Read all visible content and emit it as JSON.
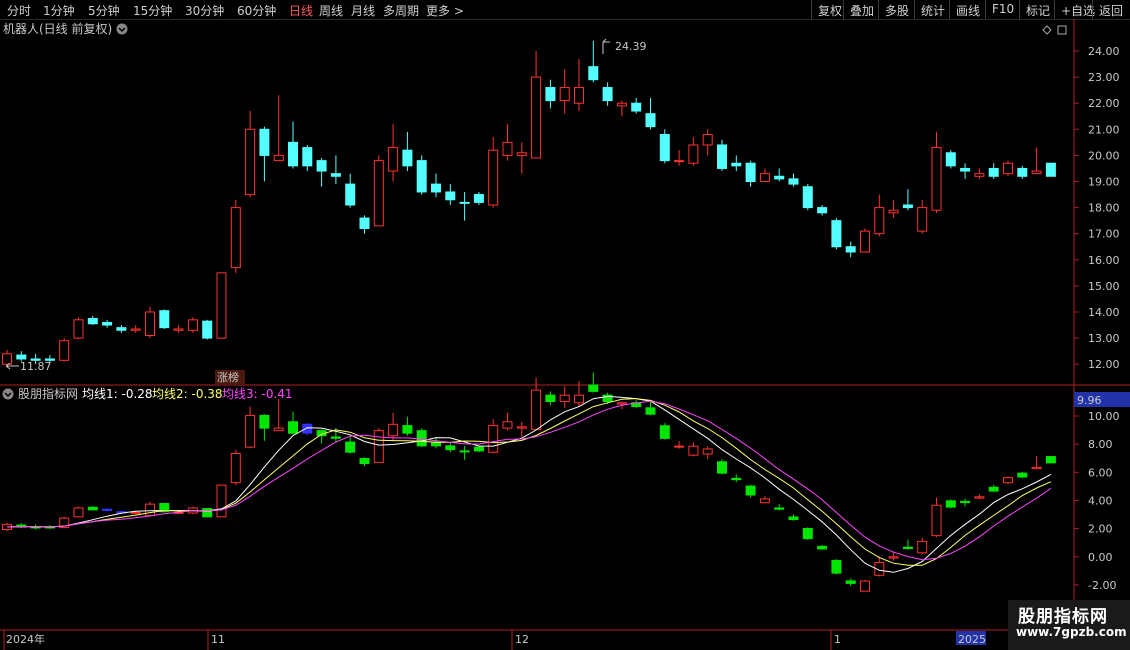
{
  "toolbar": {
    "periods": [
      "分时",
      "1分钟",
      "5分钟",
      "15分钟",
      "30分钟",
      "60分钟",
      "日线",
      "周线",
      "月线",
      "多周期",
      "更多"
    ],
    "active_period": "日线",
    "right_buttons": [
      "复权",
      "叠加",
      "多股",
      "统计",
      "画线",
      "F10",
      "标记",
      "+自选",
      "返回"
    ]
  },
  "main_chart": {
    "title": "机器人(日线 前复权)",
    "y_ticks": [
      "24.00",
      "23.00",
      "22.00",
      "21.00",
      "20.00",
      "19.00",
      "18.00",
      "17.00",
      "16.00",
      "15.00",
      "14.00",
      "13.00",
      "12.00"
    ],
    "high_marker": "24.39",
    "low_marker": "11.87",
    "event_tag": "涨榜"
  },
  "indicator": {
    "name": "股朋指标网",
    "ma1": "均线1: -0.28",
    "ma2": "均线2: -0.38",
    "ma3": "均线3: -0.41",
    "current_value": "9.96",
    "y_ticks": [
      "10.00",
      "8.00",
      "6.00",
      "4.00",
      "2.00",
      "0.00",
      "-2.00"
    ]
  },
  "x_axis": {
    "labels": [
      "2024年",
      "11",
      "12",
      "1",
      "2025"
    ]
  },
  "watermark": {
    "name": "股朋指标网",
    "url": "www.7gpzb.com"
  },
  "colors": {
    "up": "#ff3232",
    "down": "#54ffff",
    "ind_down": "#00e600",
    "ind_blue": "#3333ff",
    "ma1": "#ffffff",
    "ma2": "#ffff66",
    "ma3": "#ff44ff"
  },
  "candles": [
    [
      12.0,
      12.4,
      12.55,
      11.87,
      "u"
    ],
    [
      12.35,
      12.2,
      12.5,
      12.1,
      "d"
    ],
    [
      12.2,
      12.15,
      12.4,
      12.0,
      "d"
    ],
    [
      12.2,
      12.15,
      12.35,
      12.05,
      "d"
    ],
    [
      12.15,
      12.9,
      13.0,
      12.1,
      "u"
    ],
    [
      13.0,
      13.7,
      13.8,
      12.95,
      "u"
    ],
    [
      13.75,
      13.55,
      13.85,
      13.5,
      "d"
    ],
    [
      13.6,
      13.5,
      13.7,
      13.4,
      "d"
    ],
    [
      13.4,
      13.3,
      13.5,
      13.2,
      "d"
    ],
    [
      13.3,
      13.35,
      13.5,
      13.2,
      "u"
    ],
    [
      13.1,
      14.0,
      14.2,
      13.0,
      "u"
    ],
    [
      14.05,
      13.4,
      14.1,
      13.35,
      "d"
    ],
    [
      13.3,
      13.35,
      13.5,
      13.2,
      "u"
    ],
    [
      13.3,
      13.7,
      13.8,
      13.2,
      "u"
    ],
    [
      13.65,
      13.0,
      13.7,
      12.95,
      "d"
    ],
    [
      13.0,
      15.5,
      15.5,
      13.0,
      "u"
    ],
    [
      15.7,
      18.0,
      18.3,
      15.5,
      "u"
    ],
    [
      18.5,
      21.0,
      21.7,
      18.4,
      "u"
    ],
    [
      21.0,
      20.0,
      21.1,
      19.0,
      "d"
    ],
    [
      19.8,
      20.0,
      22.3,
      19.8,
      "u"
    ],
    [
      20.5,
      19.6,
      21.3,
      19.5,
      "d"
    ],
    [
      20.3,
      19.6,
      20.4,
      19.4,
      "d"
    ],
    [
      19.8,
      19.4,
      19.9,
      18.8,
      "d"
    ],
    [
      19.3,
      19.2,
      20.0,
      18.9,
      "d"
    ],
    [
      18.9,
      18.1,
      19.3,
      18.0,
      "d"
    ],
    [
      17.6,
      17.2,
      17.7,
      17.0,
      "d"
    ],
    [
      17.3,
      19.8,
      20.0,
      17.3,
      "u"
    ],
    [
      19.4,
      20.3,
      21.2,
      19.0,
      "u"
    ],
    [
      20.2,
      19.6,
      20.9,
      19.4,
      "d"
    ],
    [
      19.8,
      18.6,
      20.0,
      18.5,
      "d"
    ],
    [
      18.9,
      18.6,
      19.3,
      18.4,
      "d"
    ],
    [
      18.6,
      18.3,
      18.9,
      18.1,
      "d"
    ],
    [
      18.2,
      18.2,
      18.6,
      17.5,
      "d"
    ],
    [
      18.5,
      18.2,
      18.6,
      18.1,
      "d"
    ],
    [
      18.1,
      20.2,
      20.7,
      18.0,
      "u"
    ],
    [
      20.0,
      20.5,
      21.2,
      19.8,
      "u"
    ],
    [
      20.0,
      20.1,
      20.5,
      19.3,
      "u"
    ],
    [
      19.9,
      23.0,
      24.0,
      19.9,
      "u"
    ],
    [
      22.6,
      22.1,
      22.9,
      21.8,
      "d"
    ],
    [
      22.1,
      22.6,
      23.3,
      21.6,
      "u"
    ],
    [
      22.0,
      22.6,
      23.7,
      21.7,
      "u"
    ],
    [
      22.9,
      23.4,
      24.39,
      22.8,
      "d"
    ],
    [
      22.6,
      22.1,
      22.8,
      21.9,
      "d"
    ],
    [
      21.9,
      22.0,
      22.1,
      21.5,
      "u"
    ],
    [
      22.0,
      21.7,
      22.2,
      21.6,
      "d"
    ],
    [
      21.6,
      21.1,
      22.2,
      21.0,
      "d"
    ],
    [
      20.8,
      19.8,
      21.0,
      19.7,
      "d"
    ],
    [
      19.8,
      19.8,
      20.2,
      19.6,
      "u"
    ],
    [
      19.7,
      20.4,
      20.7,
      19.6,
      "u"
    ],
    [
      20.4,
      20.8,
      21.0,
      20.0,
      "u"
    ],
    [
      20.4,
      19.5,
      20.6,
      19.4,
      "d"
    ],
    [
      19.7,
      19.6,
      20.0,
      19.4,
      "d"
    ],
    [
      19.7,
      19.0,
      19.8,
      18.8,
      "d"
    ],
    [
      19.0,
      19.3,
      19.5,
      19.0,
      "u"
    ],
    [
      19.2,
      19.1,
      19.5,
      19.0,
      "d"
    ],
    [
      19.1,
      18.9,
      19.3,
      18.8,
      "d"
    ],
    [
      18.8,
      18.0,
      18.9,
      17.9,
      "d"
    ],
    [
      18.0,
      17.8,
      18.1,
      17.7,
      "d"
    ],
    [
      17.5,
      16.5,
      17.6,
      16.4,
      "d"
    ],
    [
      16.5,
      16.3,
      16.7,
      16.1,
      "d"
    ],
    [
      16.3,
      17.1,
      17.2,
      16.3,
      "u"
    ],
    [
      17.0,
      18.0,
      18.5,
      16.9,
      "u"
    ],
    [
      17.8,
      17.9,
      18.3,
      17.6,
      "u"
    ],
    [
      18.1,
      18.0,
      18.7,
      17.9,
      "d"
    ],
    [
      17.1,
      18.0,
      18.3,
      17.0,
      "u"
    ],
    [
      17.9,
      20.3,
      20.9,
      17.8,
      "u"
    ],
    [
      20.1,
      19.6,
      20.2,
      19.5,
      "d"
    ],
    [
      19.5,
      19.4,
      19.7,
      19.1,
      "d"
    ],
    [
      19.2,
      19.3,
      19.5,
      19.1,
      "u"
    ],
    [
      19.5,
      19.2,
      19.7,
      19.1,
      "d"
    ],
    [
      19.3,
      19.7,
      19.8,
      19.2,
      "u"
    ],
    [
      19.5,
      19.2,
      19.6,
      19.1,
      "d"
    ],
    [
      19.3,
      19.4,
      20.3,
      19.3,
      "u"
    ],
    [
      19.2,
      19.7,
      19.7,
      19.2,
      "d"
    ]
  ]
}
